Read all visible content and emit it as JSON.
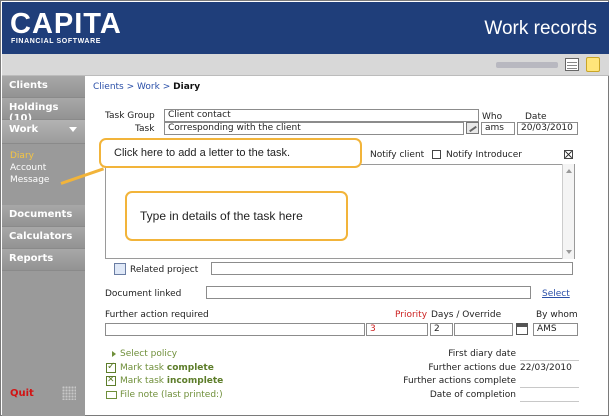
{
  "header": {
    "logo_main": "CAPITA",
    "logo_sub": "FINANCIAL SOFTWARE",
    "title": "Work records"
  },
  "toolbar": {
    "grid_icon": "grid-view-icon",
    "note_icon": "sticky-note-icon"
  },
  "sidebar": {
    "items": [
      {
        "label": "Clients"
      },
      {
        "label": "Holdings (10)"
      },
      {
        "label": "Work"
      },
      {
        "label": "Documents"
      },
      {
        "label": "Calculators"
      },
      {
        "label": "Reports"
      }
    ],
    "work_sub": [
      {
        "label": "Diary",
        "active": true
      },
      {
        "label": "Account"
      },
      {
        "label": "Message"
      }
    ],
    "quit": "Quit"
  },
  "breadcrumb": {
    "part1": "Clients",
    "sep": ">",
    "part2": "Work",
    "current": "Diary"
  },
  "form": {
    "task_group_label": "Task Group",
    "task_group_value": "Client contact",
    "task_label": "Task",
    "task_value": "Corresponding with the client",
    "who_label": "Who",
    "who_value": "ams",
    "date_label": "Date",
    "date_value": "20/03/2010",
    "notify_client_label": "Notify client",
    "notify_client_checked": false,
    "notify_introducer_label": "Notify Introducer",
    "notify_introducer_checked": true,
    "related_project_label": "Related project",
    "related_project_value": "",
    "document_linked_label": "Document linked",
    "document_linked_value": "",
    "select_link": "Select",
    "further_action_label": "Further action required",
    "further_action_value": "",
    "priority_label": "Priority",
    "priority_value": "3",
    "days_override_label": "Days / Override",
    "days_value": "2",
    "override_value": "",
    "by_whom_label": "By whom",
    "by_whom_value": "AMS"
  },
  "actions": {
    "select_policy": "Select policy",
    "mark_complete_prefix": "Mark task ",
    "mark_complete_bold": "complete",
    "mark_incomplete_prefix": "Mark task ",
    "mark_incomplete_bold": "incomplete",
    "file_note": "File note (last printed:)"
  },
  "dates": {
    "first_diary_date_label": "First diary date",
    "first_diary_date_value": "",
    "further_actions_due_label": "Further actions due",
    "further_actions_due_value": "22/03/2010",
    "further_actions_complete_label": "Further actions complete",
    "further_actions_complete_value": "",
    "date_of_completion_label": "Date of completion",
    "date_of_completion_value": ""
  },
  "callouts": {
    "letter": "Click here to add a letter to the task.",
    "details": "Type in details of the task here"
  },
  "colors": {
    "header_bg": "#1f3e7a",
    "sidebar_bg": "#9a9a9a",
    "active_sub": "#f5c542",
    "link": "#2a4fa8",
    "quit": "#d21414",
    "callout_border": "#f2b43a",
    "action_green": "#6f8f3a"
  }
}
